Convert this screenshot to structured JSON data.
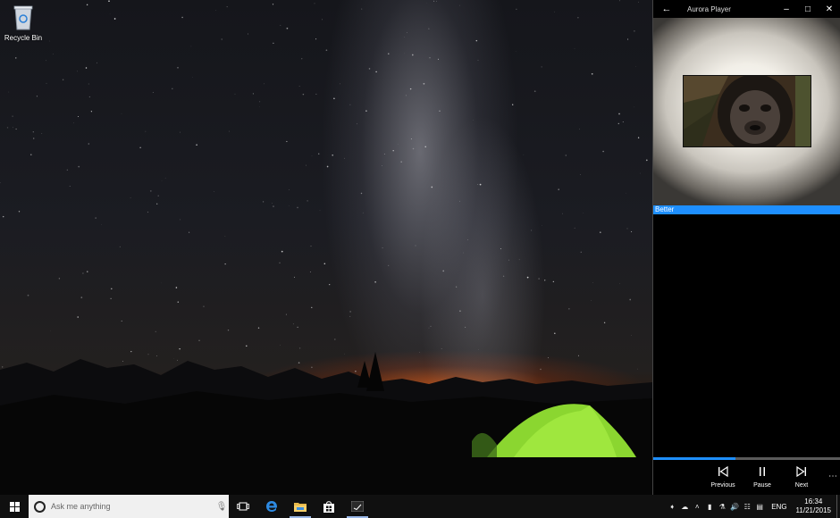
{
  "desktop": {
    "icons": [
      {
        "label": "Recycle Bin",
        "icon": "recycle-bin-icon"
      }
    ]
  },
  "app": {
    "title": "Aurora Player",
    "playlist": [
      {
        "label": "Better",
        "selected": true
      }
    ],
    "progress_fraction": 0.44,
    "controls": {
      "previous_label": "Previous",
      "pause_label": "Pause",
      "next_label": "Next"
    },
    "accent_color": "#1e8fff"
  },
  "taskbar": {
    "search_placeholder": "Ask me anything",
    "pinned": [
      "task-view-icon",
      "edge-icon",
      "file-explorer-icon",
      "store-icon",
      "aurora-player-icon"
    ],
    "tray": {
      "language": "ENG",
      "time": "16:34",
      "date": "11/21/2015"
    }
  }
}
